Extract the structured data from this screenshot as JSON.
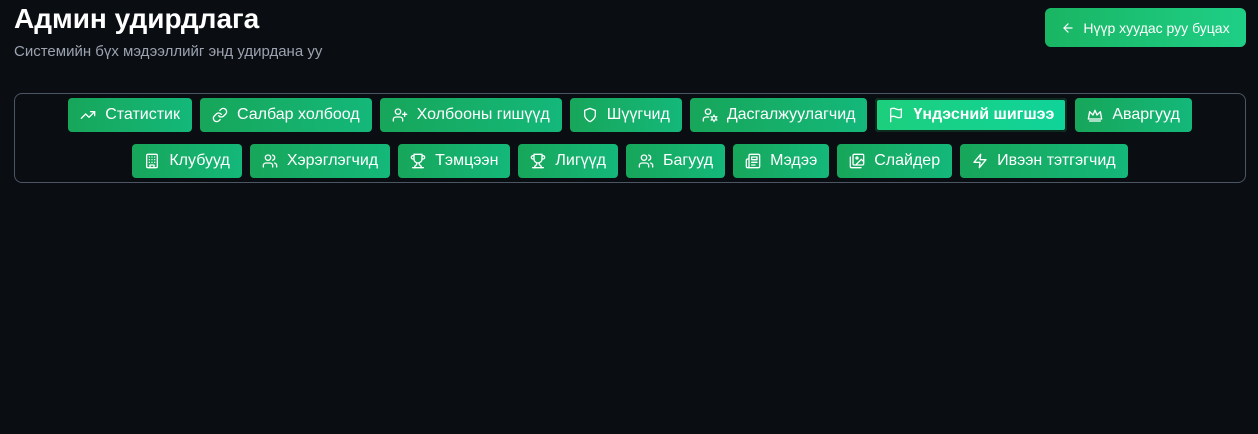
{
  "header": {
    "title": "Админ удирдлага",
    "subtitle": "Системийн бүх мэдээллийг энд удирдана уу",
    "back_button": {
      "label": "Нүүр хуудас руу буцах",
      "icon": "arrow-left-icon"
    }
  },
  "tabs": [
    {
      "label": "Статистик",
      "icon": "trending-up",
      "active": false
    },
    {
      "label": "Салбар холбоод",
      "icon": "link",
      "active": false
    },
    {
      "label": "Холбооны гишүүд",
      "icon": "user-plus",
      "active": false
    },
    {
      "label": "Шүүгчид",
      "icon": "shield",
      "active": false
    },
    {
      "label": "Дасгалжуулагчид",
      "icon": "user-cog",
      "active": false
    },
    {
      "label": "Үндэсний шигшээ",
      "icon": "flag",
      "active": true
    },
    {
      "label": "Аваргууд",
      "icon": "crown",
      "active": false
    },
    {
      "label": "Клубууд",
      "icon": "building",
      "active": false
    },
    {
      "label": "Хэрэглэгчид",
      "icon": "users",
      "active": false
    },
    {
      "label": "Тэмцээн",
      "icon": "trophy",
      "active": false
    },
    {
      "label": "Лигүүд",
      "icon": "trophy",
      "active": false
    },
    {
      "label": "Багууд",
      "icon": "users",
      "active": false
    },
    {
      "label": "Мэдээ",
      "icon": "newspaper",
      "active": false
    },
    {
      "label": "Слайдер",
      "icon": "images",
      "active": false
    },
    {
      "label": "Ивээн тэтгэгчид",
      "icon": "zap",
      "active": false
    }
  ],
  "colors": {
    "background": "#0a0e13",
    "accent": "#17a65a",
    "accent_bright": "#1fcf86",
    "subtitle": "#9ca3af",
    "panel_border": "#4b5563"
  }
}
